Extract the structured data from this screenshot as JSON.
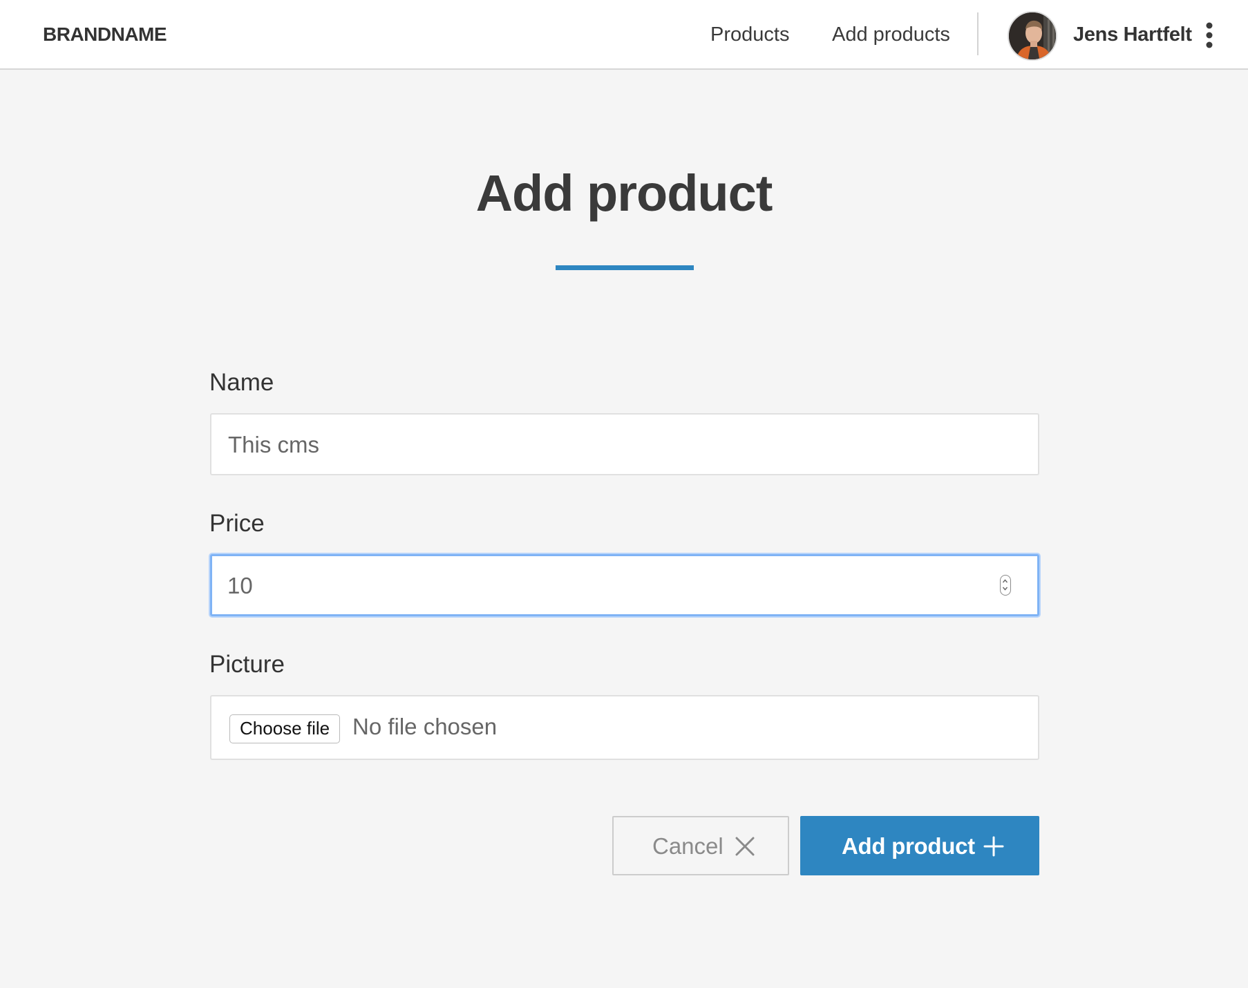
{
  "header": {
    "brand": "BRANDNAME",
    "nav": [
      {
        "label": "Products"
      },
      {
        "label": "Add products"
      }
    ],
    "user": {
      "name": "Jens Hartfelt",
      "avatar_icon": "user-avatar",
      "menu_icon": "kebab-menu-icon"
    }
  },
  "page": {
    "title": "Add product",
    "accent_color": "#2e86c1"
  },
  "form": {
    "name": {
      "label": "Name",
      "value": "This cms"
    },
    "price": {
      "label": "Price",
      "value": "10",
      "focused": true
    },
    "picture": {
      "label": "Picture",
      "button_label": "Choose file",
      "status": "No file chosen"
    }
  },
  "actions": {
    "cancel": {
      "label": "Cancel",
      "icon": "close-icon"
    },
    "submit": {
      "label": "Add product",
      "icon": "plus-icon"
    }
  }
}
